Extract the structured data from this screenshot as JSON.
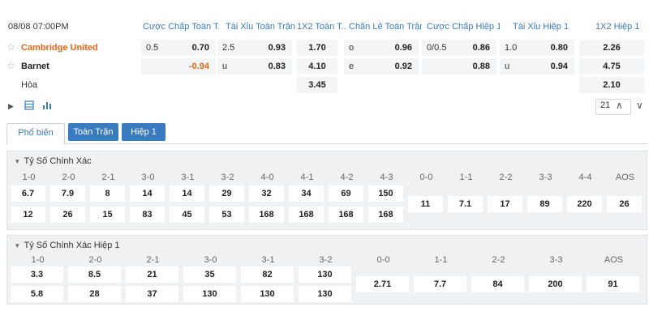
{
  "match": {
    "datetime": "08/08 07:00PM",
    "headers": [
      "Cược Chấp Toàn T...",
      "Tài Xỉu Toàn Trận",
      "1X2 Toàn T...",
      "Chẵn Lẻ Toàn Trận",
      "Cược Chấp Hiệp 1",
      "Tài Xỉu Hiệp 1",
      "1X2 Hiệp 1"
    ],
    "home": "Cambridge United",
    "away": "Barnet",
    "draw": "Hòa",
    "home_odds": {
      "hcap_line": "0.5",
      "hcap": "0.70",
      "ou_line": "2.5",
      "ou": "0.93",
      "x12": "1.70",
      "oe_lbl": "o",
      "oe": "0.96",
      "h1_hcap_line": "0/0.5",
      "h1_hcap": "0.86",
      "h1_ou_line": "1.0",
      "h1_ou": "0.80",
      "h1_x12": "2.26"
    },
    "away_odds": {
      "hcap_line": "",
      "hcap": "-0.94",
      "ou_line": "u",
      "ou": "0.83",
      "x12": "4.10",
      "oe_lbl": "e",
      "oe": "0.92",
      "h1_hcap_line": "",
      "h1_hcap": "0.88",
      "h1_ou_line": "u",
      "h1_ou": "0.94",
      "h1_x12": "4.75"
    },
    "draw_odds": {
      "x12": "3.45",
      "h1_x12": "2.10"
    },
    "page": "21"
  },
  "icons": {
    "expand": "play-triangle-icon",
    "layout": "layout-icon",
    "stats": "bar-chart-icon",
    "up": "chevron-up-icon",
    "down": "chevron-down-icon",
    "star": "star-icon"
  },
  "tabs": [
    "Phổ biến",
    "Toàn Trận",
    "Hiệp 1"
  ],
  "correct_score": {
    "title": "Tỷ Số Chính Xác",
    "labels": [
      "1-0",
      "2-0",
      "2-1",
      "3-0",
      "3-1",
      "3-2",
      "4-0",
      "4-1",
      "4-2",
      "4-3",
      "0-0",
      "1-1",
      "2-2",
      "3-3",
      "4-4",
      "AOS"
    ],
    "row1": [
      "6.7",
      "7.9",
      "8",
      "14",
      "14",
      "29",
      "32",
      "34",
      "69",
      "150"
    ],
    "row2": [
      "12",
      "26",
      "15",
      "83",
      "45",
      "53",
      "168",
      "168",
      "168",
      "168"
    ],
    "single": [
      "11",
      "7.1",
      "17",
      "89",
      "220",
      "26"
    ]
  },
  "correct_score_h1": {
    "title": "Tỷ Số Chính Xác Hiệp 1",
    "labels": [
      "1-0",
      "2-0",
      "2-1",
      "3-0",
      "3-1",
      "3-2",
      "0-0",
      "1-1",
      "2-2",
      "3-3",
      "AOS"
    ],
    "row1": [
      "3.3",
      "8.5",
      "21",
      "35",
      "82",
      "130"
    ],
    "row2": [
      "5.8",
      "28",
      "37",
      "130",
      "130",
      "130"
    ],
    "single": [
      "2.71",
      "7.7",
      "84",
      "200",
      "91"
    ]
  },
  "colors": {
    "accent": "#3a7bbf",
    "home": "#e8651a",
    "negative": "#e8651a",
    "panel_bg": "#f0f1f3"
  }
}
